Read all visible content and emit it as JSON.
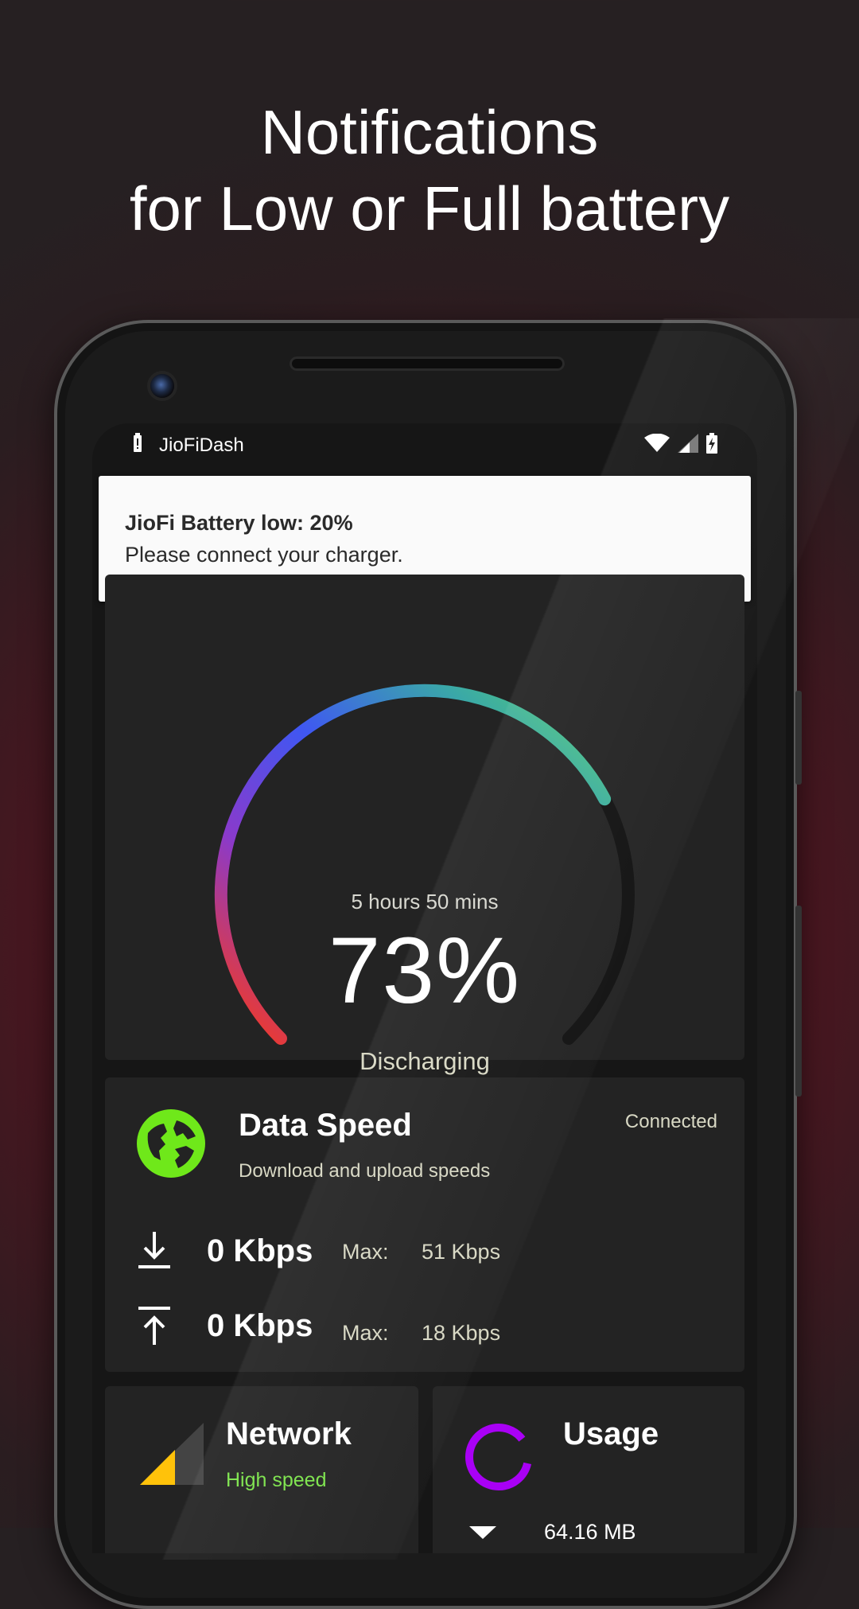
{
  "headline": {
    "line1": "Notifications",
    "line2": "for Low or Full battery"
  },
  "statusbar": {
    "app_name": "JioFiDash",
    "icons": [
      "battery-alert-icon",
      "wifi-icon",
      "cell-signal-icon",
      "battery-charging-icon"
    ]
  },
  "notification": {
    "title": "JioFi Battery low: 20%",
    "body": "Please connect your charger."
  },
  "battery": {
    "time_remaining": "5 hours 50 mins",
    "percent_text": "73%",
    "percent_value": 0.73,
    "state": "Discharging",
    "colors": [
      "#ff3a10",
      "#8a3acb",
      "#3f57f2",
      "#3aa8a8",
      "#58d36c"
    ]
  },
  "data_speed": {
    "title": "Data Speed",
    "subtitle": "Download and upload speeds",
    "status": "Connected",
    "download": {
      "value": "0 Kbps",
      "max_label": "Max:",
      "max_value": "51 Kbps"
    },
    "upload": {
      "value": "0 Kbps",
      "max_label": "Max:",
      "max_value": "18 Kbps"
    },
    "icon_color": "#6fe81a"
  },
  "network": {
    "title": "Network",
    "subtitle": "High speed",
    "icon_color": "#ffc20a"
  },
  "usage": {
    "title": "Usage",
    "value": "64.16 MB",
    "icon_color": "#a900f5"
  }
}
